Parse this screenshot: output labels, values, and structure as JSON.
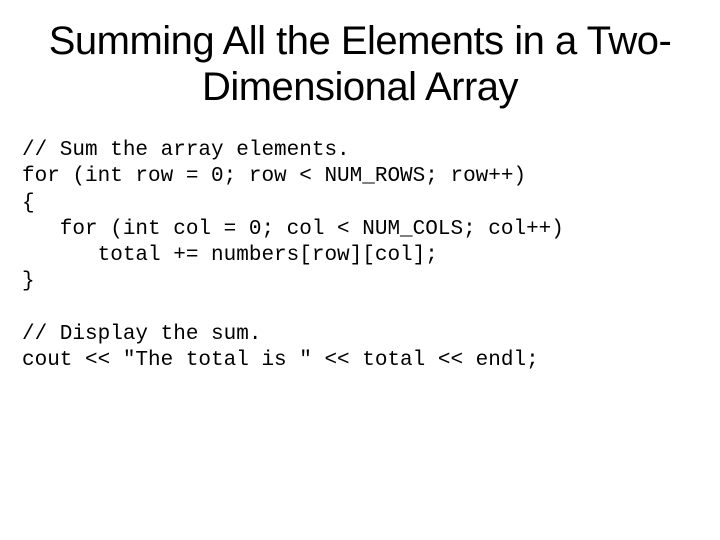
{
  "title": "Summing All the Elements in a Two-Dimensional Array",
  "code1": "// Sum the array elements.\nfor (int row = 0; row < NUM_ROWS; row++)\n{\n   for (int col = 0; col < NUM_COLS; col++)\n      total += numbers[row][col];\n}",
  "code2": "// Display the sum.\ncout << \"The total is \" << total << endl;"
}
